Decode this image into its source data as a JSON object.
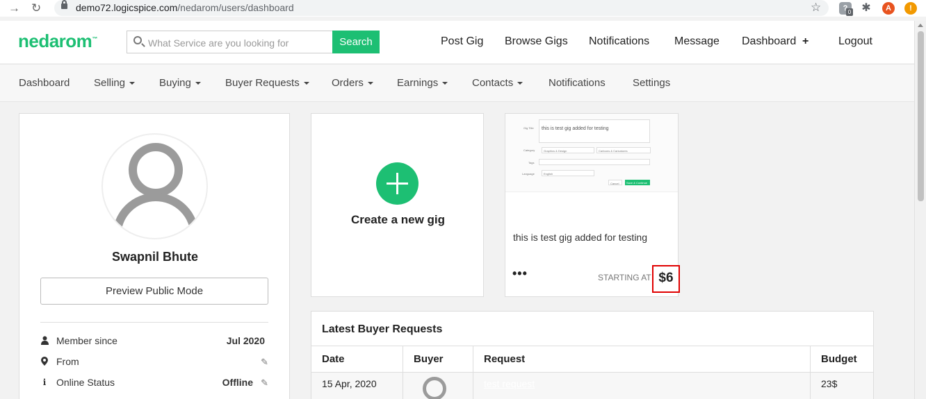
{
  "browser": {
    "url_host": "demo72.logicspice.com",
    "url_path": "/nedarom/users/dashboard",
    "ext_badge": "0",
    "profile_initial": "A",
    "alert_symbol": "!"
  },
  "header": {
    "logo": "nedarom",
    "logo_tm": "™",
    "search_placeholder": "What Service are you looking for",
    "search_button": "Search",
    "links": [
      "Post Gig",
      "Browse Gigs",
      "Notifications",
      "Message",
      "Dashboard",
      "Logout"
    ],
    "dashboard_plus": "+"
  },
  "subnav": {
    "items": [
      "Dashboard",
      "Selling",
      "Buying",
      "Buyer Requests",
      "Orders",
      "Earnings",
      "Contacts",
      "Notifications",
      "Settings"
    ]
  },
  "profile": {
    "name": "Swapnil Bhute",
    "preview_button": "Preview Public Mode",
    "member_since_label": "Member since",
    "member_since_value": "Jul 2020",
    "from_label": "From",
    "online_status_label": "Online Status",
    "online_status_value": "Offline"
  },
  "create_gig": {
    "label": "Create a new gig"
  },
  "gig": {
    "thumb_title_label": "Gig Title",
    "thumb_title_text": "this is test gig added for testing",
    "thumb_category_label": "Category",
    "thumb_category_value": "Graphics & Design",
    "thumb_subcategory_value": "Cartoons & Caricatures",
    "thumb_tags_label": "Tags",
    "thumb_language_label": "Language",
    "thumb_language_value": "English",
    "thumb_cancel": "Cancel",
    "thumb_save": "Save & Continue",
    "title": "this is test gig added for testing",
    "more": "•••",
    "starting_at": "STARTING AT",
    "price": "$6"
  },
  "requests": {
    "title": "Latest Buyer Requests",
    "columns": [
      "Date",
      "Buyer",
      "Request",
      "Budget"
    ],
    "rows": [
      {
        "date": "15 Apr, 2020",
        "request": "test request",
        "budget": "23$"
      }
    ]
  },
  "colors": {
    "brand": "#1dbf73",
    "highlight": "#e00000"
  }
}
